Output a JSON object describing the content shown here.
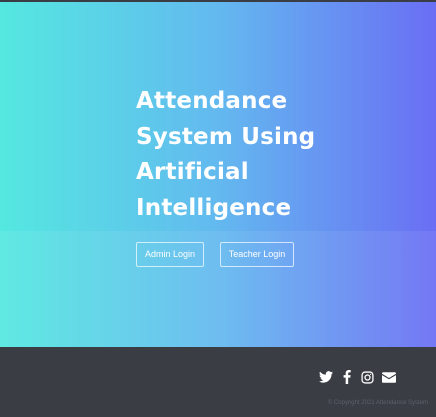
{
  "hero": {
    "title_lines": [
      "Attendance",
      "System Using",
      "Artificial",
      "Intelligence"
    ],
    "buttons": {
      "admin_login": "Admin Login",
      "teacher_login": "Teacher Login"
    }
  },
  "footer": {
    "social_icons": [
      "twitter-icon",
      "facebook-icon",
      "instagram-icon",
      "envelope-icon"
    ],
    "copyright": "© Copyright 2021 Attendance System"
  },
  "colors": {
    "gradient_start": "#54e8e0",
    "gradient_end": "#6a6ef4",
    "footer_bg": "#3a3d44",
    "text": "#ffffff"
  }
}
